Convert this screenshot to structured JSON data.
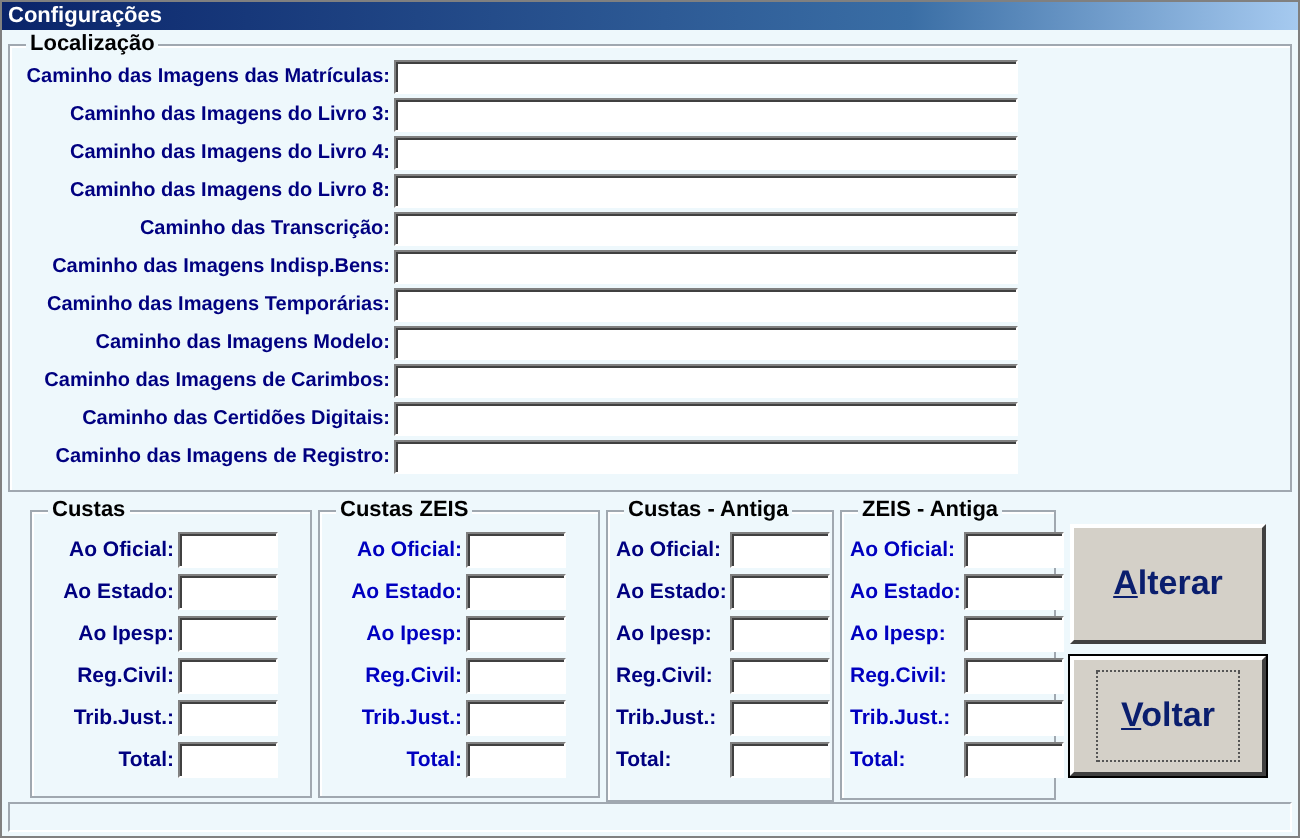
{
  "window": {
    "title": "Configurações"
  },
  "localizacao": {
    "title": "Localização",
    "fields": [
      {
        "label": "Caminho das Imagens das Matrículas:"
      },
      {
        "label": "Caminho das Imagens do Livro 3:"
      },
      {
        "label": "Caminho das Imagens do Livro 4:"
      },
      {
        "label": "Caminho das Imagens do Livro 8:"
      },
      {
        "label": "Caminho das Transcrição:"
      },
      {
        "label": "Caminho das Imagens Indisp.Bens:"
      },
      {
        "label": "Caminho das Imagens Temporárias:"
      },
      {
        "label": "Caminho das Imagens Modelo:"
      },
      {
        "label": "Caminho das Imagens de Carimbos:"
      },
      {
        "label": "Caminho das Certidões Digitais:"
      },
      {
        "label": "Caminho das Imagens de Registro:"
      }
    ]
  },
  "groups": [
    {
      "title": "Custas",
      "color": "#000080",
      "kind": "right",
      "fields": [
        "Ao Oficial:",
        "Ao Estado:",
        "Ao Ipesp:",
        "Reg.Civil:",
        "Trib.Just.:",
        "Total:"
      ]
    },
    {
      "title": "Custas ZEIS",
      "color": "#0000c0",
      "kind": "right",
      "fields": [
        "Ao Oficial:",
        "Ao Estado:",
        "Ao Ipesp:",
        "Reg.Civil:",
        "Trib.Just.:",
        "Total:"
      ]
    },
    {
      "title": "Custas - Antiga",
      "color": "#000080",
      "kind": "left",
      "fields": [
        "Ao Oficial:",
        "Ao Estado:",
        "Ao Ipesp:",
        "Reg.Civil:",
        "Trib.Just.:",
        "Total:"
      ]
    },
    {
      "title": "ZEIS - Antiga",
      "color": "#0000c0",
      "kind": "left",
      "fields": [
        "Ao Oficial:",
        "Ao Estado:",
        "Ao Ipesp:",
        "Reg.Civil:",
        "Trib.Just.:",
        "Total:"
      ]
    }
  ],
  "buttons": [
    {
      "label": "Alterar",
      "access_key": true,
      "focused": false
    },
    {
      "label": "Voltar",
      "access_key": true,
      "focused": true
    }
  ]
}
